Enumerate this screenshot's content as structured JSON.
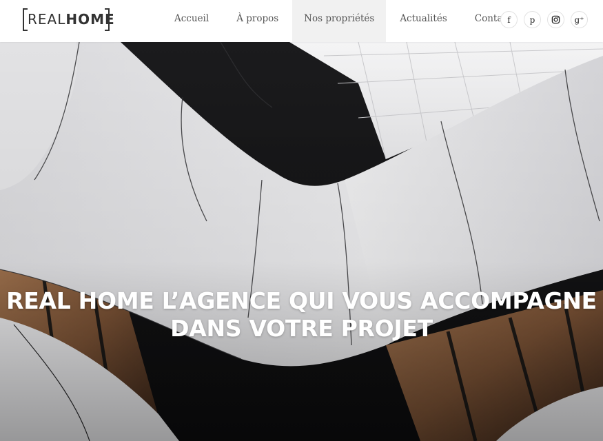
{
  "brand": {
    "logo_thin": "REAL",
    "logo_bold": "HOME"
  },
  "nav": [
    {
      "label": "Accueil",
      "active": false
    },
    {
      "label": "À propos",
      "active": false
    },
    {
      "label": "Nos propriétés",
      "active": true
    },
    {
      "label": "Actualités",
      "active": false
    },
    {
      "label": "Contact",
      "active": false
    }
  ],
  "social": [
    {
      "icon": "facebook-icon",
      "glyph": "f"
    },
    {
      "icon": "pinterest-icon",
      "glyph": "p"
    },
    {
      "icon": "instagram-icon",
      "glyph": ""
    },
    {
      "icon": "google-plus-icon",
      "glyph": "g⁺"
    }
  ],
  "hero": {
    "title_line1": "REAL HOME L’AGENCE QUI VOUS ACCOMPAGNE",
    "title_line2": "DANS VOTRE PROJET"
  },
  "colors": {
    "nav_active_bg": "#f1f1f1",
    "text_dark": "#333333",
    "hero_text": "#ffffff"
  }
}
